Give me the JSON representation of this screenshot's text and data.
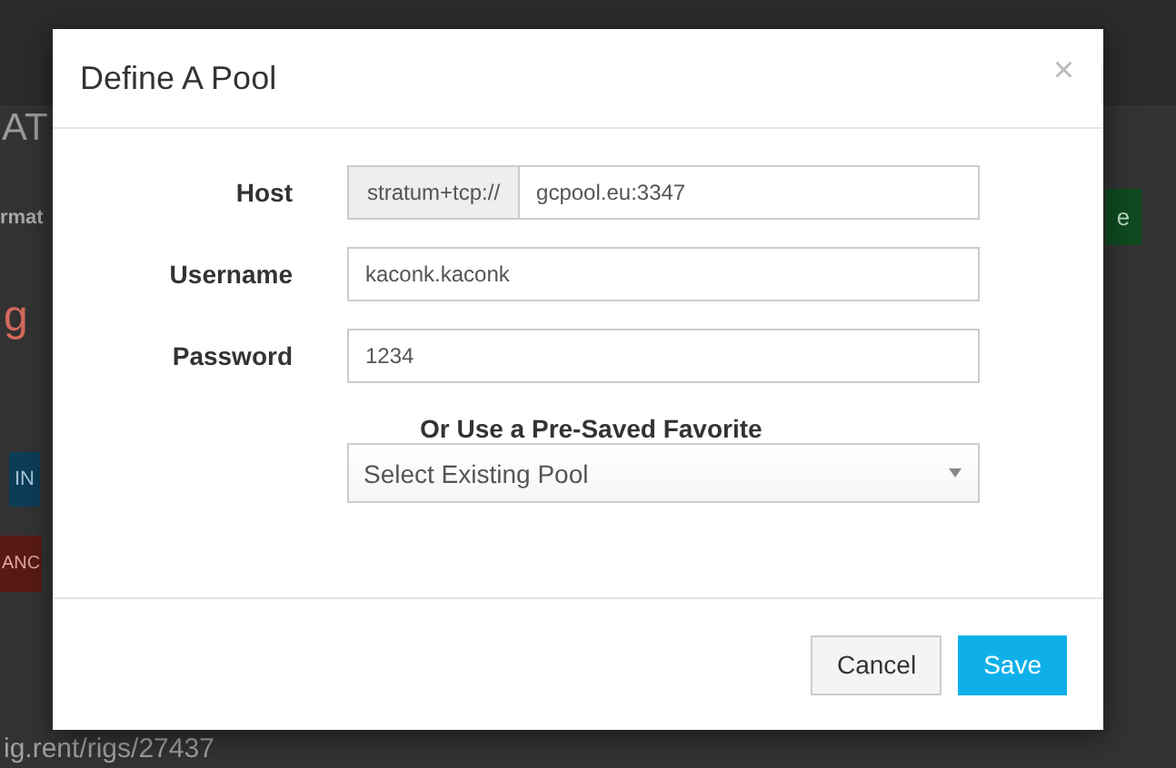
{
  "background": {
    "heading": "AT",
    "tab_label": "rmat",
    "subheading": "g",
    "info_button": "IN",
    "cancel_button": "ANC",
    "green_button": "e",
    "url": "ig.rent/rigs/27437"
  },
  "dialog": {
    "title": "Define A Pool",
    "close": "×",
    "host": {
      "label": "Host",
      "prefix": "stratum+tcp://",
      "value": "gcpool.eu:3347"
    },
    "username": {
      "label": "Username",
      "value": "kaconk.kaconk"
    },
    "password": {
      "label": "Password",
      "value": "1234"
    },
    "favorite": {
      "label": "Or Use a Pre-Saved Favorite",
      "placeholder": "Select Existing Pool"
    },
    "buttons": [
      {
        "label": "Cancel",
        "kind": "default"
      },
      {
        "label": "Save",
        "kind": "primary"
      }
    ]
  }
}
